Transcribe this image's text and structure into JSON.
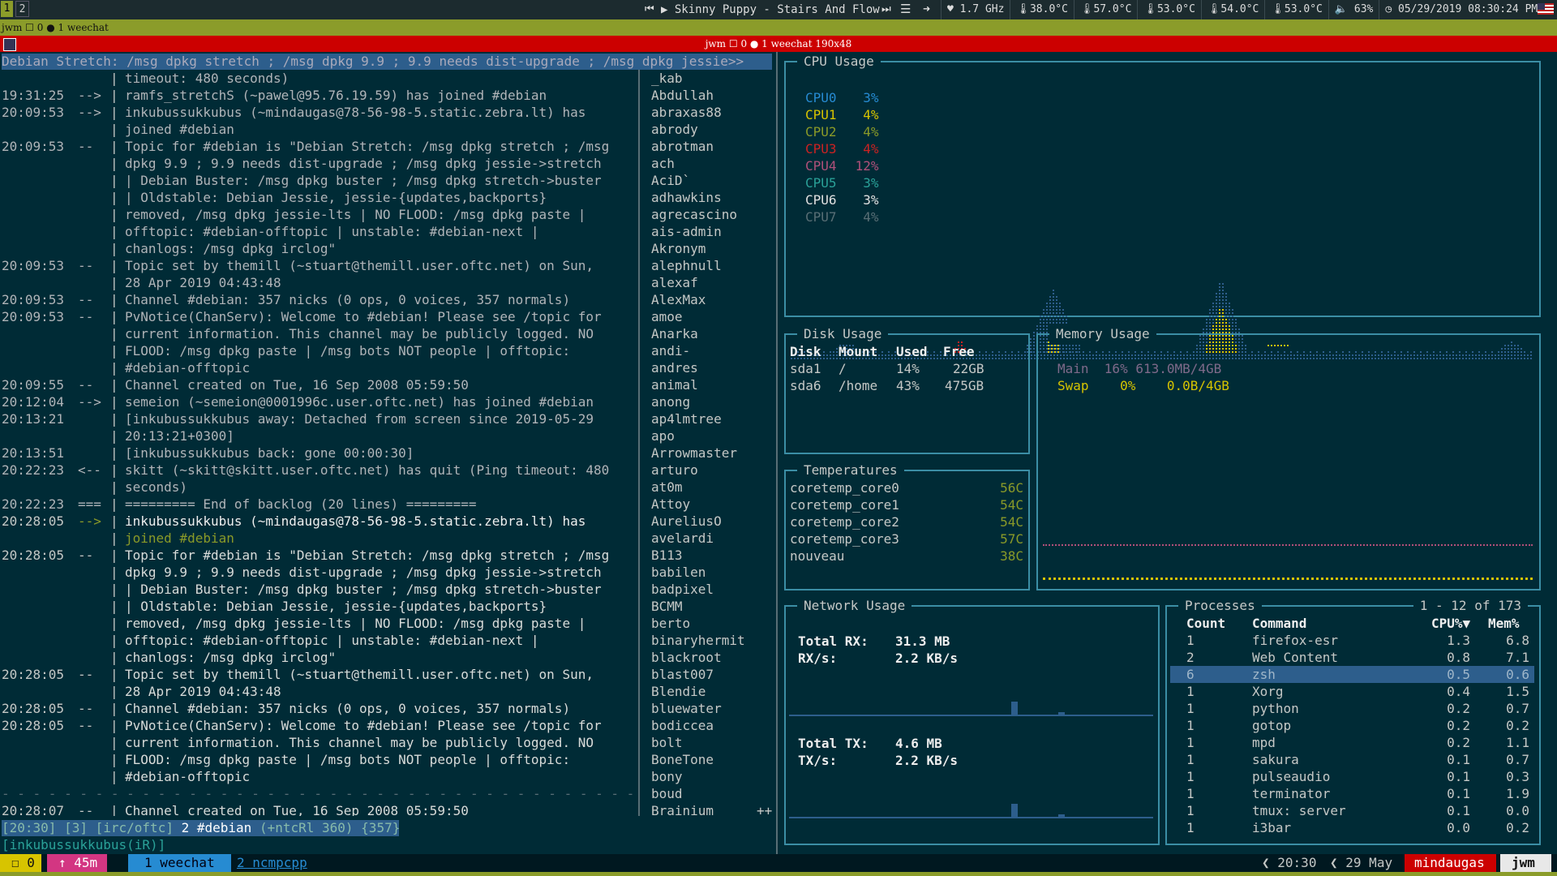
{
  "topbar": {
    "workspaces": [
      "1",
      "2"
    ],
    "now_playing": "▶ Skinny Puppy - Stairs And Flow",
    "stats": [
      "1.7 GHz",
      "38.0°C",
      "57.0°C",
      "53.0°C",
      "54.0°C",
      "53.0°C",
      "63%",
      "05/29/2019 08:30:24 PM"
    ]
  },
  "jwm_bar": "jwm ☐ 0 ● 1 weechat",
  "window_title": "jwm ☐ 0 ● 1 weechat 190x48",
  "weechat": {
    "topic": "Debian Stretch: /msg dpkg stretch ; /msg dpkg 9.9 ; 9.9 needs dist-upgrade ; /msg dpkg jessie>>",
    "lines": [
      {
        "t": "",
        "p": "",
        "m": "timeout: 480 seconds)",
        "c": "dim"
      },
      {
        "t": "19:31:25",
        "p": "-->",
        "m": "ramfs_stretchS (~pawel@95.76.19.59) has joined #debian",
        "c": "dim"
      },
      {
        "t": "20:09:53",
        "p": "-->",
        "m": "inkubussukkubus (~mindaugas@78-56-98-5.static.zebra.lt) has",
        "c": "dim"
      },
      {
        "t": "",
        "p": "",
        "m": "joined #debian",
        "c": "dim"
      },
      {
        "t": "20:09:53",
        "p": "--",
        "m": "Topic for #debian is \"Debian Stretch: /msg dpkg stretch ; /msg",
        "c": "dim"
      },
      {
        "t": "",
        "p": "",
        "m": "dpkg 9.9 ; 9.9 needs dist-upgrade ; /msg dpkg jessie->stretch",
        "c": "dim"
      },
      {
        "t": "",
        "p": "",
        "m": "| Debian Buster: /msg dpkg buster ; /msg dpkg stretch->buster",
        "c": "dim"
      },
      {
        "t": "",
        "p": "",
        "m": "| Oldstable: Debian Jessie, jessie-{updates,backports}",
        "c": "dim"
      },
      {
        "t": "",
        "p": "",
        "m": "removed, /msg dpkg jessie-lts | NO FLOOD: /msg dpkg paste |",
        "c": "dim"
      },
      {
        "t": "",
        "p": "",
        "m": "offtopic: #debian-offtopic | unstable: #debian-next |",
        "c": "dim"
      },
      {
        "t": "",
        "p": "",
        "m": "chanlogs: /msg dpkg irclog\"",
        "c": "dim"
      },
      {
        "t": "20:09:53",
        "p": "--",
        "m": "Topic set by themill (~stuart@themill.user.oftc.net) on Sun,",
        "c": "dim"
      },
      {
        "t": "",
        "p": "",
        "m": "28 Apr 2019 04:43:48",
        "c": "dim"
      },
      {
        "t": "20:09:53",
        "p": "--",
        "m": "Channel #debian: 357 nicks (0 ops, 0 voices, 357 normals)",
        "c": "dim"
      },
      {
        "t": "20:09:53",
        "p": "--",
        "m": "PvNotice(ChanServ): Welcome to #debian! Please see /topic for",
        "c": "dim"
      },
      {
        "t": "",
        "p": "",
        "m": "current information. This channel may be publicly logged. NO",
        "c": "dim"
      },
      {
        "t": "",
        "p": "",
        "m": "FLOOD: /msg dpkg paste | /msg bots NOT people | offtopic:",
        "c": "dim"
      },
      {
        "t": "",
        "p": "",
        "m": "#debian-offtopic",
        "c": "dim"
      },
      {
        "t": "20:09:55",
        "p": "--",
        "m": "Channel created on Tue, 16 Sep 2008 05:59:50",
        "c": "dim"
      },
      {
        "t": "20:12:04",
        "p": "-->",
        "m": "semeion (~semeion@0001996c.user.oftc.net) has joined #debian",
        "c": "dim"
      },
      {
        "t": "20:13:21",
        "p": "",
        "m": "[inkubussukkubus away: Detached from screen since 2019-05-29",
        "c": "dim"
      },
      {
        "t": "",
        "p": "",
        "m": "20:13:21+0300]",
        "c": "dim"
      },
      {
        "t": "20:13:51",
        "p": "",
        "m": "[inkubussukkubus back: gone 00:00:30]",
        "c": "dim"
      },
      {
        "t": "20:22:23",
        "p": "<--",
        "m": "skitt (~skitt@skitt.user.oftc.net) has quit (Ping timeout: 480",
        "c": "dim"
      },
      {
        "t": "",
        "p": "",
        "m": "seconds)",
        "c": "dim"
      },
      {
        "t": "20:22:23",
        "p": "===",
        "m": "========= End of backlog (20 lines) =========",
        "c": "dim"
      },
      {
        "t": "20:28:05",
        "p": "-->",
        "m": "inkubussukkubus (~mindaugas@78-56-98-5.static.zebra.lt) has",
        "c": "join"
      },
      {
        "t": "",
        "p": "",
        "m": "joined #debian",
        "c": "join2"
      },
      {
        "t": "20:28:05",
        "p": "--",
        "m": "Topic for #debian is \"Debian Stretch: /msg dpkg stretch ; /msg",
        "c": "new"
      },
      {
        "t": "",
        "p": "",
        "m": "dpkg 9.9 ; 9.9 needs dist-upgrade ; /msg dpkg jessie->stretch",
        "c": "new"
      },
      {
        "t": "",
        "p": "",
        "m": "| Debian Buster: /msg dpkg buster ; /msg dpkg stretch->buster",
        "c": "new"
      },
      {
        "t": "",
        "p": "",
        "m": "| Oldstable: Debian Jessie, jessie-{updates,backports}",
        "c": "new"
      },
      {
        "t": "",
        "p": "",
        "m": "removed, /msg dpkg jessie-lts | NO FLOOD: /msg dpkg paste |",
        "c": "new"
      },
      {
        "t": "",
        "p": "",
        "m": "offtopic: #debian-offtopic | unstable: #debian-next |",
        "c": "new"
      },
      {
        "t": "",
        "p": "",
        "m": "chanlogs: /msg dpkg irclog\"",
        "c": "new"
      },
      {
        "t": "20:28:05",
        "p": "--",
        "m": "Topic set by themill (~stuart@themill.user.oftc.net) on Sun,",
        "c": "new"
      },
      {
        "t": "",
        "p": "",
        "m": "28 Apr 2019 04:43:48",
        "c": "new"
      },
      {
        "t": "20:28:05",
        "p": "--",
        "m": "Channel #debian: 357 nicks (0 ops, 0 voices, 357 normals)",
        "c": "new"
      },
      {
        "t": "20:28:05",
        "p": "--",
        "m": "PvNotice(ChanServ): Welcome to #debian! Please see /topic for",
        "c": "new"
      },
      {
        "t": "",
        "p": "",
        "m": "current information. This channel may be publicly logged. NO",
        "c": "new"
      },
      {
        "t": "",
        "p": "",
        "m": "FLOOD: /msg dpkg paste | /msg bots NOT people | offtopic:",
        "c": "new"
      },
      {
        "t": "",
        "p": "",
        "m": "#debian-offtopic",
        "c": "new"
      }
    ],
    "read_marker": "- - - - - - - - - - - - - - - - - - - - - - - - - - - - - - - - - - - - - - - - -",
    "last_line": {
      "t": "20:28:07",
      "p": "--",
      "m": "Channel created on Tue, 16 Sep 2008 05:59:50"
    },
    "nicks": [
      "_kab",
      "Abdullah",
      "abraxas88",
      "abrody",
      "abrotman",
      "ach",
      "AciD`",
      "adhawkins",
      "agrecascino",
      "ais-admin",
      "Akronym",
      "alephnull",
      "alexaf",
      "AlexMax",
      "amoe",
      "Anarka",
      "andi-",
      "andres",
      "animal",
      "anong",
      "ap4lmtree",
      "apo",
      "Arrowmaster",
      "arturo",
      "at0m",
      "Attoy",
      "AureliusO",
      "avelardi",
      "B113",
      "babilen",
      "badpixel",
      "BCMM",
      "berto",
      "binaryhermit",
      "blackroot",
      "blast007",
      "Blendie",
      "bluewater",
      "bodiccea",
      "bolt",
      "BoneTone",
      "bony",
      "boud",
      "Brainium"
    ],
    "nick_more": "++",
    "status": {
      "time": "[20:30]",
      "num": "[3]",
      "server": "[irc/oftc]",
      "channel": "2 #debian",
      "modes": "(+ntcRl 360)",
      "count": "{357}"
    },
    "input": "[inkubussukkubus(iR)]"
  },
  "bottombar": {
    "left": [
      "☐ 0",
      "↑ 45m",
      "1 weechat",
      "2 ncmpcpp"
    ],
    "right": [
      "20:30",
      "29 May",
      "mindaugas",
      "jwm"
    ]
  },
  "cpu": {
    "title": "CPU Usage",
    "cores": [
      {
        "name": "CPU0",
        "val": "3%",
        "color": "#268bd2"
      },
      {
        "name": "CPU1",
        "val": "4%",
        "color": "#d7c400"
      },
      {
        "name": "CPU2",
        "val": "4%",
        "color": "#8a9a28"
      },
      {
        "name": "CPU3",
        "val": "4%",
        "color": "#cc2222"
      },
      {
        "name": "CPU4",
        "val": "12%",
        "color": "#b0507a"
      },
      {
        "name": "CPU5",
        "val": "3%",
        "color": "#2aa198"
      },
      {
        "name": "CPU6",
        "val": "3%",
        "color": "#e0e0e0"
      },
      {
        "name": "CPU7",
        "val": "4%",
        "color": "#586e75"
      }
    ]
  },
  "disk": {
    "title": "Disk Usage",
    "headers": [
      "Disk",
      "Mount",
      "Used",
      "Free"
    ],
    "rows": [
      [
        "sda1",
        "/",
        "14%",
        "22GB"
      ],
      [
        "sda6",
        "/home",
        "43%",
        "475GB"
      ]
    ]
  },
  "memory": {
    "title": "Memory Usage",
    "rows": [
      {
        "label": "Main",
        "pct": "16%",
        "val": "613.0MB/4GB",
        "color": "#7f6a8a"
      },
      {
        "label": "Swap",
        "pct": "0%",
        "val": "0.0B/4GB",
        "color": "#d7c400"
      }
    ]
  },
  "temps": {
    "title": "Temperatures",
    "rows": [
      [
        "coretemp_core0",
        "56C"
      ],
      [
        "coretemp_core1",
        "54C"
      ],
      [
        "coretemp_core2",
        "54C"
      ],
      [
        "coretemp_core3",
        "57C"
      ],
      [
        "nouveau",
        "38C"
      ]
    ]
  },
  "network": {
    "title": "Network Usage",
    "rx_total_label": "Total RX:",
    "rx_total": "31.3 MB",
    "rx_rate_label": "RX/s:",
    "rx_rate": "2.2 KB/s",
    "tx_total_label": "Total TX:",
    "tx_total": "4.6 MB",
    "tx_rate_label": "TX/s:",
    "tx_rate": "2.2 KB/s"
  },
  "processes": {
    "title": "Processes",
    "range": "1 - 12 of 173",
    "headers": [
      "Count",
      "Command",
      "CPU%▼",
      "Mem%"
    ],
    "rows": [
      [
        "1",
        "firefox-esr",
        "1.3",
        "6.8"
      ],
      [
        "2",
        "Web Content",
        "0.8",
        "7.1"
      ],
      [
        "6",
        "zsh",
        "0.5",
        "0.6"
      ],
      [
        "1",
        "Xorg",
        "0.4",
        "1.5"
      ],
      [
        "1",
        "python",
        "0.2",
        "0.7"
      ],
      [
        "1",
        "gotop",
        "0.2",
        "0.2"
      ],
      [
        "1",
        "mpd",
        "0.2",
        "1.1"
      ],
      [
        "1",
        "sakura",
        "0.1",
        "0.7"
      ],
      [
        "1",
        "pulseaudio",
        "0.1",
        "0.3"
      ],
      [
        "1",
        "terminator",
        "0.1",
        "1.9"
      ],
      [
        "1",
        "tmux: server",
        "0.1",
        "0.0"
      ],
      [
        "1",
        "i3bar",
        "0.0",
        "0.2"
      ]
    ],
    "selected": 2
  }
}
